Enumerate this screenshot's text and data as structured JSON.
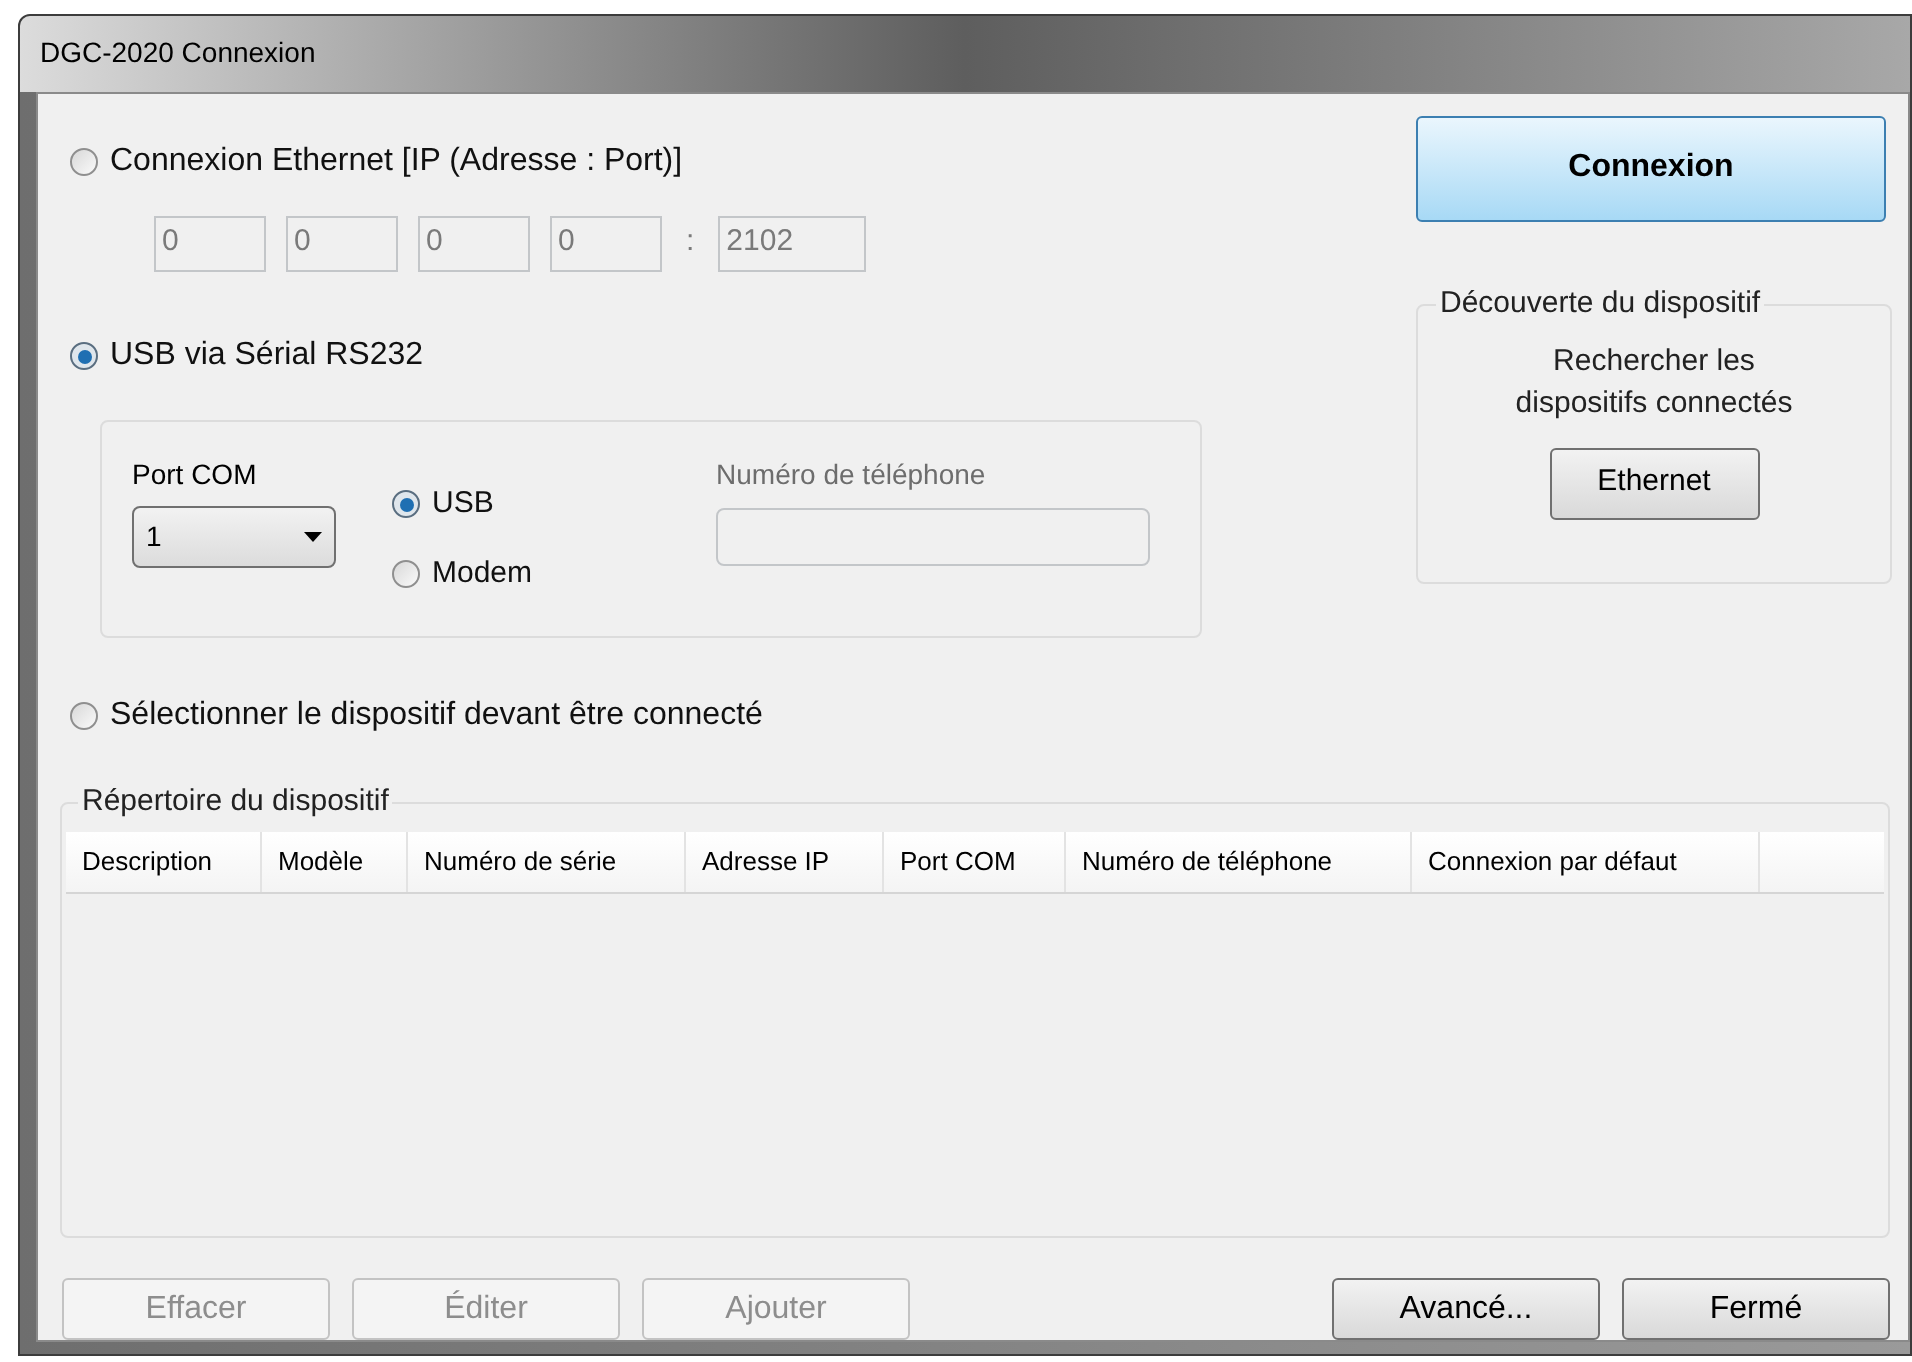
{
  "window": {
    "title": "DGC-2020 Connexion"
  },
  "ethernet": {
    "label": "Connexion Ethernet [IP (Adresse : Port)]",
    "selected": false,
    "disabled": true,
    "ip_octets": [
      "0",
      "0",
      "0",
      "0"
    ],
    "separator": ":",
    "port": "2102"
  },
  "serial": {
    "label": "USB via Sérial RS232",
    "selected": true,
    "port_com": {
      "label": "Port COM",
      "value": "1"
    },
    "link_options": [
      {
        "label": "USB",
        "selected": true
      },
      {
        "label": "Modem",
        "selected": false
      }
    ],
    "phone": {
      "label": "Numéro de téléphone",
      "disabled": true
    }
  },
  "connect_button": "Connexion",
  "discovery": {
    "title": "Découverte du dispositif",
    "text": "Rechercher les dispositifs connectés",
    "button": "Ethernet"
  },
  "directory_mode": {
    "label": "Sélectionner le dispositif devant être connecté",
    "selected": false
  },
  "directory": {
    "title": "Répertoire du dispositif",
    "columns": [
      "Description",
      "Modèle",
      "Numéro de série",
      "Adresse IP",
      "Port COM",
      "Numéro de téléphone",
      "Connexion par défaut"
    ]
  },
  "buttons": [
    {
      "label": "Effacer",
      "disabled": true
    },
    {
      "label": "Éditer",
      "disabled": true
    },
    {
      "label": "Ajouter",
      "disabled": true
    },
    {
      "label": "Avancé...",
      "disabled": false
    },
    {
      "label": "Fermé",
      "disabled": false
    }
  ]
}
